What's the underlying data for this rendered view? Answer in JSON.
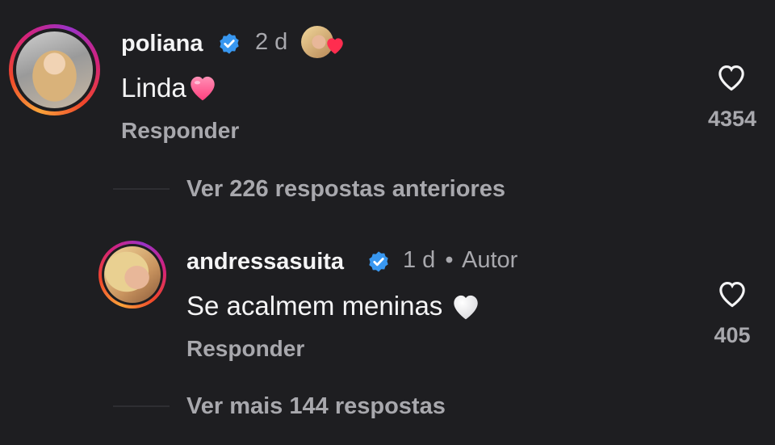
{
  "comments": [
    {
      "username": "poliana",
      "time": "2 d",
      "text": "Linda",
      "text_emoji": "pink-heart",
      "reply_label": "Responder",
      "like_count": "4354",
      "verified": true,
      "liked_by_author": true
    },
    {
      "username": "andressasuita",
      "time": "1 d",
      "separator": "•",
      "author_badge": "Autor",
      "text": "Se acalmem meninas",
      "text_emoji": "white-heart",
      "reply_label": "Responder",
      "like_count": "405",
      "verified": true
    }
  ],
  "threads": {
    "previous_replies": "Ver 226 respostas anteriores",
    "more_replies": "Ver mais 144 respostas"
  },
  "colors": {
    "background": "#1e1e21",
    "primary_text": "#f4f4f5",
    "secondary_text": "#a8a8ad",
    "verified_blue": "#3897f0",
    "heart_red": "#ff2d4f",
    "pink_heart": "#ff5c93"
  }
}
